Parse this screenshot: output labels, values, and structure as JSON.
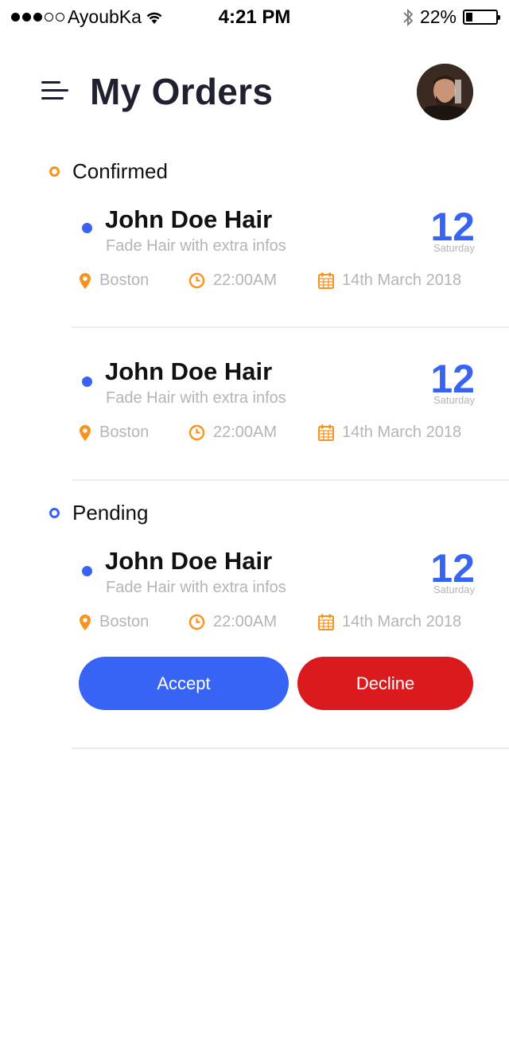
{
  "status_bar": {
    "carrier": "AyoubKa",
    "time": "4:21 PM",
    "battery": "22%",
    "battery_level": 0.22,
    "signal_bars_filled": 3,
    "signal_bars_total": 5
  },
  "header": {
    "title": "My Orders",
    "menu_icon": "hamburger-menu-icon",
    "avatar_icon": "user-avatar"
  },
  "colors": {
    "accent_blue": "#3764f5",
    "accent_orange": "#f7931e",
    "decline_red": "#db1a1e",
    "muted_text": "#b5b5b5"
  },
  "sections": [
    {
      "label": "Confirmed",
      "orders": [
        {
          "name": "John Doe Hair",
          "service": "Fade Hair with extra infos",
          "day_number": "12",
          "day_name": "Saturday",
          "location": "Boston",
          "time": "22:00AM",
          "date": "14th March 2018"
        },
        {
          "name": "John Doe Hair",
          "service": "Fade Hair with extra infos",
          "day_number": "12",
          "day_name": "Saturday",
          "location": "Boston",
          "time": "22:00AM",
          "date": "14th March 2018"
        }
      ]
    },
    {
      "label": "Pending",
      "orders": [
        {
          "name": "John Doe Hair",
          "service": "Fade Hair with extra infos",
          "day_number": "12",
          "day_name": "Saturday",
          "location": "Boston",
          "time": "22:00AM",
          "date": "14th March 2018"
        }
      ],
      "actions": {
        "accept": "Accept",
        "decline": "Decline"
      }
    }
  ]
}
